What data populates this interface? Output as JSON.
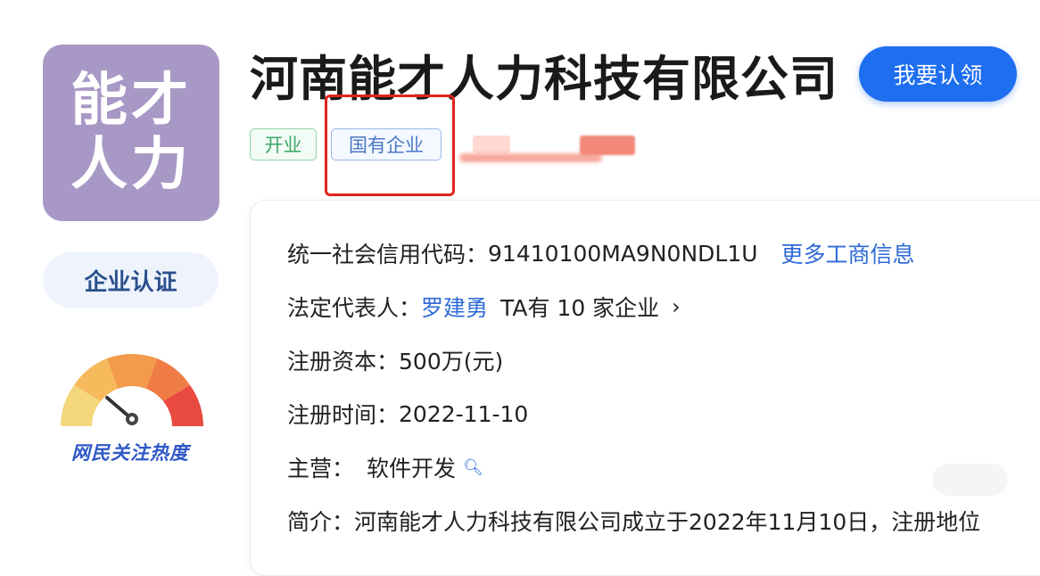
{
  "logo": {
    "line1": "能才",
    "line2": "人力"
  },
  "company": {
    "name": "河南能才人力科技有限公司"
  },
  "claim_button": {
    "label": "我要认领"
  },
  "tags": [
    {
      "label": "开业"
    },
    {
      "label": "国有企业"
    }
  ],
  "sidebar": {
    "certification": "企业认证",
    "gauge_label": "网民关注热度"
  },
  "info": {
    "credit_code_label": "统一社会信用代码：",
    "credit_code": "91410100MA9N0NDL1U",
    "more_link": "更多工商信息",
    "legal_rep_label": "法定代表人：",
    "legal_rep_name": "罗建勇",
    "legal_rep_companies": "TA有 10 家企业",
    "capital_label": "注册资本：",
    "capital": "500万(元)",
    "reg_date_label": "注册时间：",
    "reg_date": "2022-11-10",
    "business_label": "主营：",
    "business": "软件开发",
    "intro_label": "简介：",
    "intro": "河南能才人力科技有限公司成立于2022年11月10日，注册地位"
  },
  "colors": {
    "logo_bg": "#a898c6",
    "accent": "#1e6ef0",
    "tag_green": "#3aa866",
    "tag_blue": "#4a78c4",
    "highlight": "#e0241c"
  }
}
